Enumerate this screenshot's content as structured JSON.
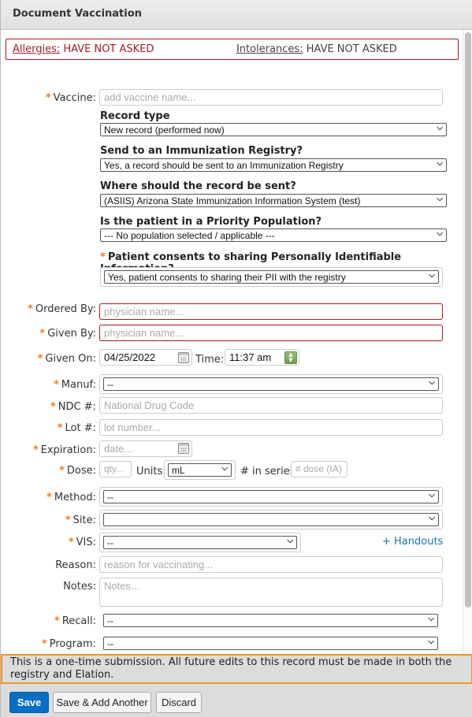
{
  "dialog": {
    "title": "Document Vaccination"
  },
  "alerts": {
    "allergies_label": "Allergies:",
    "allergies_value": "HAVE NOT ASKED",
    "intolerances_label": "Intolerances:",
    "intolerances_value": "HAVE NOT ASKED"
  },
  "required_marker": "*",
  "form": {
    "vaccine": {
      "label": "Vaccine:",
      "placeholder": "add vaccine name..."
    },
    "record_type": {
      "heading": "Record type",
      "value": "New record (performed now)"
    },
    "send_registry": {
      "heading": "Send to an Immunization Registry?",
      "value": "Yes, a record should be sent to an Immunization Registry"
    },
    "registry_dest": {
      "heading": "Where should the record be sent?",
      "value": "(ASIIS) Arizona State Immunization Information System (test)"
    },
    "priority_population": {
      "heading": "Is the patient in a Priority Population?",
      "value": "--- No population selected / applicable ---"
    },
    "pii_consent": {
      "heading": "Patient consents to sharing Personally Identifiable Information?",
      "value": "Yes, patient consents to sharing their PII with the registry"
    },
    "ordered_by": {
      "label": "Ordered By:",
      "placeholder": "physician name..."
    },
    "given_by": {
      "label": "Given By:",
      "placeholder": "physician name..."
    },
    "given_on": {
      "label": "Given On:",
      "value": "04/25/2022"
    },
    "time": {
      "label": "Time:",
      "value": "11:37 am"
    },
    "manuf": {
      "label": "Manuf:",
      "value": "--"
    },
    "ndc": {
      "label": "NDC #:",
      "placeholder": "National Drug Code"
    },
    "lot": {
      "label": "Lot #:",
      "placeholder": "lot number..."
    },
    "expiration": {
      "label": "Expiration:",
      "placeholder": "date..."
    },
    "dose": {
      "label": "Dose:",
      "placeholder": "qty..."
    },
    "units": {
      "label": "Units:",
      "value": "mL"
    },
    "series": {
      "label": "# in series:",
      "placeholder": "# dose (IA)"
    },
    "method": {
      "label": "Method:",
      "value": "--"
    },
    "site": {
      "label": "Site:",
      "value": ""
    },
    "vis": {
      "label": "VIS:",
      "value": "--"
    },
    "handouts_link": "+ Handouts",
    "reason": {
      "label": "Reason:",
      "placeholder": "reason for vaccinating..."
    },
    "notes": {
      "label": "Notes:",
      "placeholder": "Notes..."
    },
    "recall": {
      "label": "Recall:",
      "value": "--"
    },
    "program": {
      "label": "Program:",
      "value": "--"
    }
  },
  "notice": "This is a one-time submission. All future edits to this record must be made in both the registry and Elation.",
  "buttons": {
    "save": "Save",
    "save_add_another": "Save & Add Another",
    "discard": "Discard"
  },
  "icons": {
    "chevron": "⌄",
    "spin_up": "▲",
    "spin_down": "▼"
  }
}
